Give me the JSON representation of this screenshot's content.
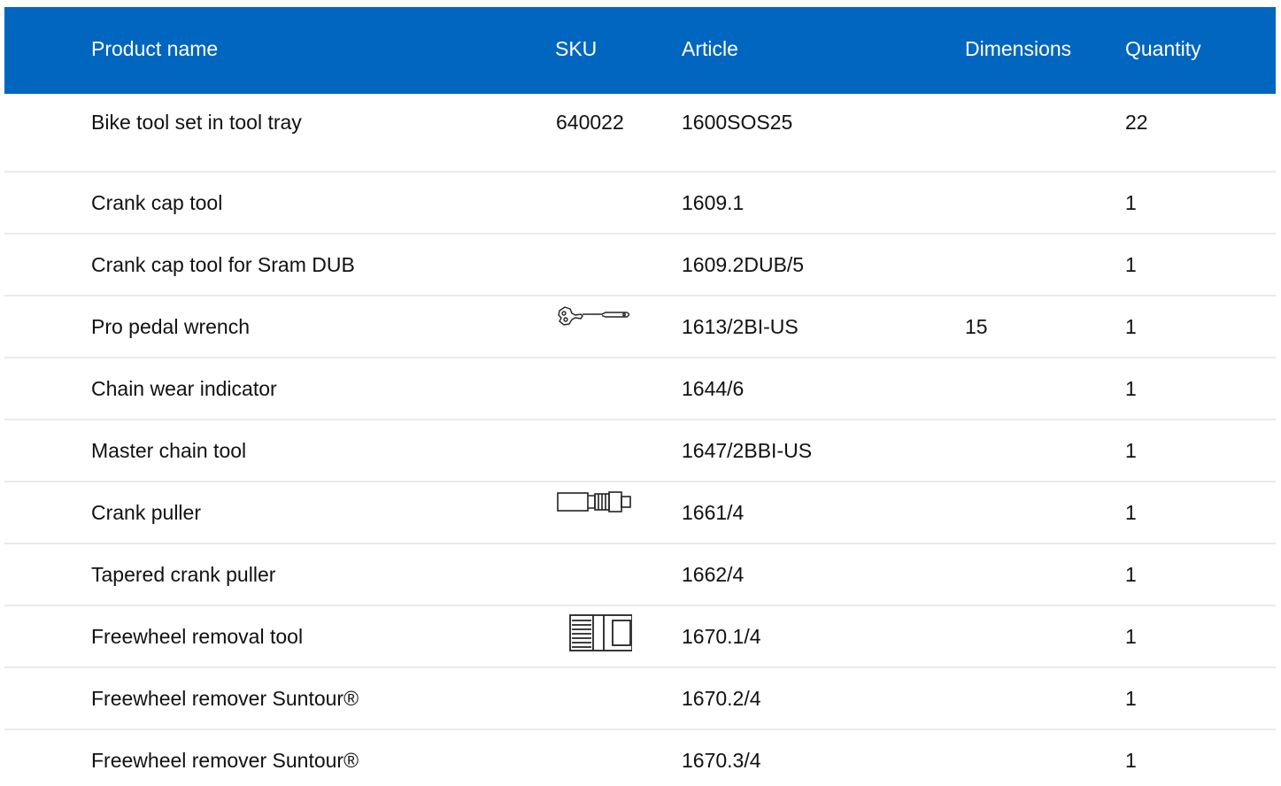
{
  "table": {
    "columns": [
      "Product name",
      "SKU",
      "Article",
      "Dimensions",
      "Quantity"
    ],
    "rows": [
      {
        "name": "Bike tool set in tool tray",
        "sku": "640022",
        "article": "1600SOS25",
        "dimensions": "",
        "quantity": "22",
        "icon": ""
      },
      {
        "name": "Crank cap tool",
        "sku": "",
        "article": "1609.1",
        "dimensions": "",
        "quantity": "1",
        "icon": ""
      },
      {
        "name": "Crank cap tool for Sram DUB",
        "sku": "",
        "article": "1609.2DUB/5",
        "dimensions": "",
        "quantity": "1",
        "icon": ""
      },
      {
        "name": "Pro pedal wrench",
        "sku": "",
        "article": "1613/2BI-US",
        "dimensions": "15",
        "quantity": "1",
        "icon": "pedal-wrench-icon"
      },
      {
        "name": "Chain wear indicator",
        "sku": "",
        "article": "1644/6",
        "dimensions": "",
        "quantity": "1",
        "icon": ""
      },
      {
        "name": "Master chain tool",
        "sku": "",
        "article": "1647/2BBI-US",
        "dimensions": "",
        "quantity": "1",
        "icon": ""
      },
      {
        "name": "Crank puller",
        "sku": "",
        "article": "1661/4",
        "dimensions": "",
        "quantity": "1",
        "icon": "crank-puller-icon"
      },
      {
        "name": "Tapered crank puller",
        "sku": "",
        "article": "1662/4",
        "dimensions": "",
        "quantity": "1",
        "icon": ""
      },
      {
        "name": "Freewheel removal tool",
        "sku": "",
        "article": "1670.1/4",
        "dimensions": "",
        "quantity": "1",
        "icon": "freewheel-tool-icon"
      },
      {
        "name": "Freewheel remover Suntour®",
        "sku": "",
        "article": "1670.2/4",
        "dimensions": "",
        "quantity": "1",
        "icon": ""
      },
      {
        "name": "Freewheel remover Suntour®",
        "sku": "",
        "article": "1670.3/4",
        "dimensions": "",
        "quantity": "1",
        "icon": ""
      }
    ]
  },
  "colors": {
    "header_bg": "#0066bf",
    "header_text": "#ffffff",
    "row_divider": "#eaeaea"
  }
}
